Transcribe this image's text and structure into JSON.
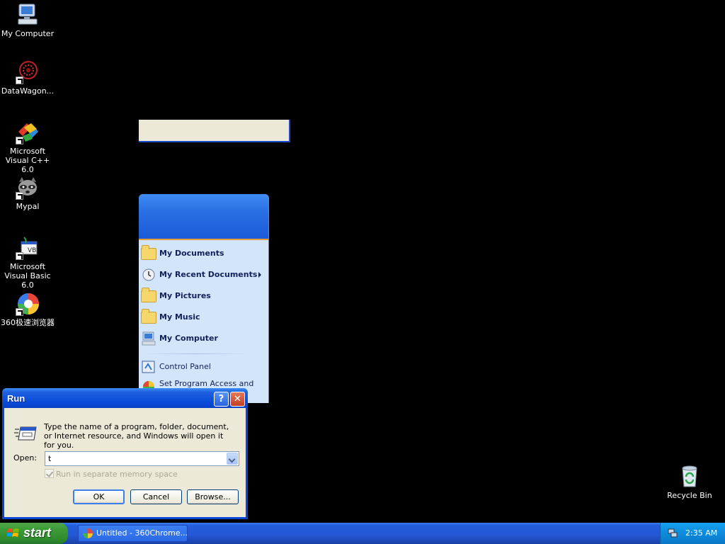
{
  "desktop": {
    "icons": [
      {
        "label": "My Computer"
      },
      {
        "label": "DataWagon..."
      },
      {
        "label": "Microsoft Visual C++ 6.0"
      },
      {
        "label": "Mypal"
      },
      {
        "label": "Microsoft Visual Basic 6.0"
      },
      {
        "label": "360极速浏览器"
      }
    ],
    "recycle_bin": "Recycle Bin"
  },
  "start_menu": {
    "items": [
      {
        "label": "My Documents",
        "icon": "my-documents-icon"
      },
      {
        "label": "My Recent Documents",
        "icon": "recent-documents-icon",
        "has_submenu": true
      },
      {
        "label": "My Pictures",
        "icon": "my-pictures-icon"
      },
      {
        "label": "My Music",
        "icon": "my-music-icon"
      },
      {
        "label": "My Computer",
        "icon": "my-computer-icon"
      },
      {
        "label": "Control Panel",
        "icon": "control-panel-icon"
      },
      {
        "label": "Set Program Access and",
        "icon": "program-access-icon"
      }
    ]
  },
  "run_dialog": {
    "title": "Run",
    "help_label": "?",
    "close_label": "✕",
    "description": "Type the name of a program, folder, document, or Internet resource, and Windows will open it for you.",
    "open_label": "Open:",
    "open_value": "t",
    "separate_memory_label": "Run in separate memory space",
    "ok_label": "OK",
    "cancel_label": "Cancel",
    "browse_label": "Browse..."
  },
  "taskbar": {
    "start_label": "start",
    "task_label": "Untitled - 360Chrome...",
    "clock": "2:35 AM"
  },
  "colors": {
    "taskbar_blue": "#245edb",
    "start_green": "#3c9c37",
    "dialog_face": "#ece9d8",
    "title_blue": "#0a4bd9"
  }
}
